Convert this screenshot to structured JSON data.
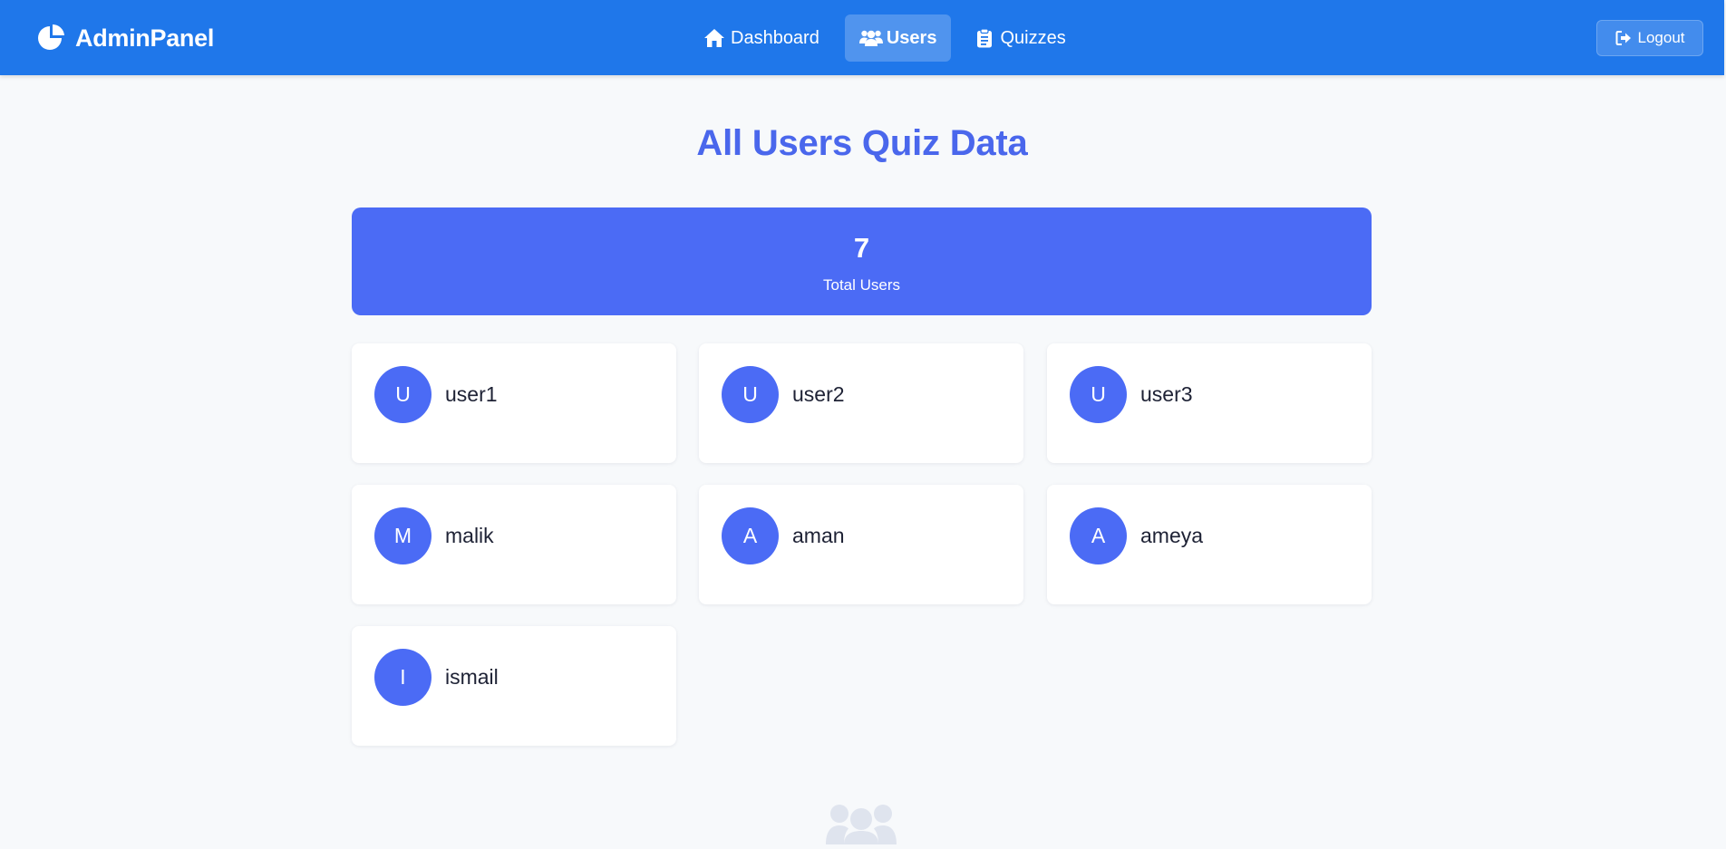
{
  "navbar": {
    "brand": "AdminPanel",
    "brand_icon": "pie-chart-icon",
    "links": [
      {
        "label": "Dashboard",
        "icon": "home-icon",
        "active": false
      },
      {
        "label": "Users",
        "icon": "users-icon",
        "active": true
      },
      {
        "label": "Quizzes",
        "icon": "clipboard-icon",
        "active": false
      }
    ],
    "logout_label": "Logout",
    "logout_icon": "sign-out-icon",
    "color": "#1f77ea"
  },
  "main": {
    "title": "All Users Quiz Data",
    "stats": {
      "value": "7",
      "label": "Total Users",
      "color": "#4b6bf5"
    },
    "users": [
      {
        "initial": "U",
        "name": "user1"
      },
      {
        "initial": "U",
        "name": "user2"
      },
      {
        "initial": "U",
        "name": "user3"
      },
      {
        "initial": "M",
        "name": "malik"
      },
      {
        "initial": "A",
        "name": "aman"
      },
      {
        "initial": "A",
        "name": "ameya"
      },
      {
        "initial": "I",
        "name": "ismail"
      }
    ],
    "footer_icon": "users-icon"
  }
}
